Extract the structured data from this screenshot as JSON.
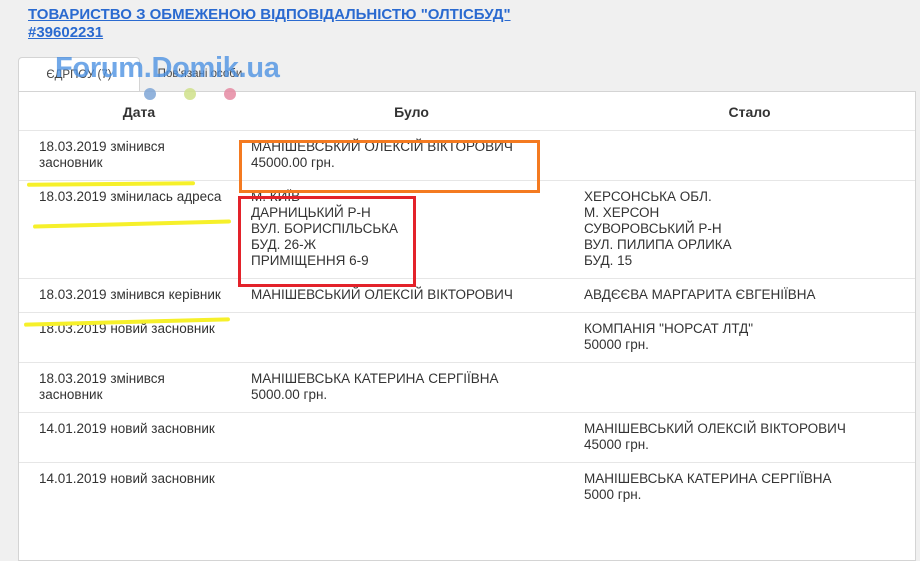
{
  "header": {
    "company_name": "ТОВАРИСТВО З ОБМЕЖЕНОЮ ВІДПОВІДАЛЬНІСТЮ \"ОЛТІСБУД\"",
    "company_id": "#39602231"
  },
  "tabs": [
    {
      "label": "ЄДРПОУ (7)",
      "active": true
    },
    {
      "label": "Пов'язані особи",
      "active": false
    }
  ],
  "watermark": "Forum.Domik.ua",
  "watermark_dot_colors": [
    "#7fa6d6",
    "#cfe08a",
    "#e58aa2"
  ],
  "table": {
    "columns": [
      "Дата",
      "Було",
      "Стало"
    ],
    "rows": [
      {
        "date": [
          "18.03.2019 змінився",
          "засновник"
        ],
        "was": [
          "МАНІШЕВСЬКИЙ ОЛЕКСІЙ ВІКТОРОВИЧ",
          "45000.00 грн."
        ],
        "became": []
      },
      {
        "date": [
          "18.03.2019 змінилась адреса"
        ],
        "was": [
          "М. КИЇВ",
          "ДАРНИЦЬКИЙ Р-Н",
          "ВУЛ. БОРИСПІЛЬСЬКА",
          "БУД. 26-Ж",
          "ПРИМІЩЕННЯ 6-9"
        ],
        "became": [
          "ХЕРСОНСЬКА ОБЛ.",
          "М. ХЕРСОН",
          "СУВОРОВСЬКИЙ Р-Н",
          "ВУЛ. ПИЛИПА ОРЛИКА",
          "БУД. 15"
        ]
      },
      {
        "date": [
          "18.03.2019 змінився керівник"
        ],
        "was": [
          "МАНІШЕВСЬКИЙ ОЛЕКСІЙ ВІКТОРОВИЧ"
        ],
        "became": [
          "АВДЄЄВА МАРГАРИТА ЄВГЕНІЇВНА"
        ]
      },
      {
        "date": [
          "18.03.2019 новий засновник"
        ],
        "was": [],
        "became": [
          "КОМПАНІЯ \"НОРСАТ ЛТД\"",
          "50000 грн."
        ]
      },
      {
        "date": [
          "18.03.2019 змінився",
          "засновник"
        ],
        "was": [
          "МАНІШЕВСЬКА КАТЕРИНА СЕРГІЇВНА",
          "5000.00 грн."
        ],
        "became": []
      },
      {
        "date": [
          "14.01.2019 новий засновник"
        ],
        "was": [],
        "became": [
          "МАНІШЕВСЬКИЙ ОЛЕКСІЙ ВІКТОРОВИЧ",
          "45000 грн."
        ]
      },
      {
        "date": [
          "14.01.2019 новий засновник"
        ],
        "was": [],
        "became": [
          "МАНІШЕВСЬКА КАТЕРИНА СЕРГІЇВНА",
          "5000 грн."
        ]
      }
    ]
  },
  "annotations": {
    "highlight_color": "#f6f02a",
    "box_orange_color": "#f47a20",
    "box_red_color": "#e3222a"
  }
}
